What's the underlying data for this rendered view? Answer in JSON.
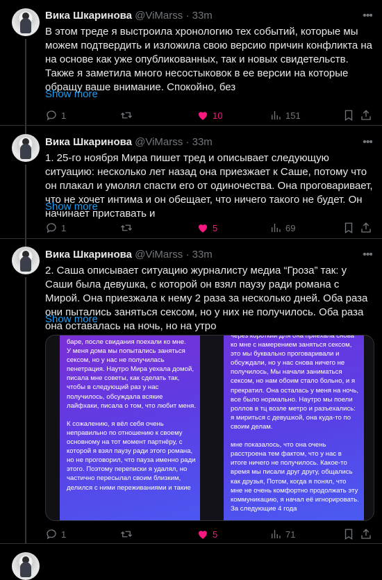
{
  "tweets": [
    {
      "author_name": "Вика Шкаринова",
      "handle": "@ViMarss",
      "dot": "·",
      "time": "33m",
      "text": "В этом треде я выстроила хронологию тех событий, которые мы можем подтвердить и изложила свою версию причин конфликта на на основе как уже опубликованных, так и новых свидетельств. Также я заметила много несостыковок в ее версии на которые обращу ваше внимание. Спокойно, без",
      "show_more": "Show more",
      "replies": "1",
      "reposts": "",
      "likes": "10",
      "views": "151"
    },
    {
      "author_name": "Вика Шкаринова",
      "handle": "@ViMarss",
      "dot": "·",
      "time": "33m",
      "text": "1. 25-го ноября Мира пишет тред и описывает следующую ситуацию: несколько лет назад она приезжает к Саше, потому что он плакал и умолял спасти его от одиночества. Она проговаривает, что не хочет интима и он обещает, что ничего такого не будет. Он начинает приставать и",
      "show_more": "Show more",
      "replies": "1",
      "reposts": "",
      "likes": "5",
      "views": "69"
    },
    {
      "author_name": "Вика Шкаринова",
      "handle": "@ViMarss",
      "dot": "·",
      "time": "33m",
      "text": "2. Саша описывает ситуацию журналисту медиа “Гроза” так: у Саши была девушка, с которой он взял паузу ради романа с Мирой. Она приезжала к нему 2 раза за несколько дней. Оба раза они пытались заняться сексом, но у них не получилось. Оба раза она оставалась на ночь, но на утро",
      "show_more": "Show more",
      "replies": "1",
      "reposts": "",
      "likes": "5",
      "views": "71",
      "media": {
        "left_text": "баре, после свидания поехали ко мне.\nУ меня дома мы попытались заняться сексом, но у нас не получилась пенетрация. Наутро Мира уехала домой, писала мне советы, как сделать так, чтобы в следующий раз у нас получилось, обсуждала всякие лайфхаки, писала о том, что любит меня.\n\nК сожалению, я вёл себя очень неправильно по отношению к своему основному на тот момент партнёру, с которой я взял паузу ради этого романа, но не проговорил, что пауза именно ради этого. Поэтому переписки я удалял, но частично пересылал своим близким, делился с ними переживаниями и такие",
        "right_text": "через короткий для она приехала снова ко мне с намерением заняться сексом, это мы буквально проговаривали и обсуждали, но у нас снова ничего не получилось, Мы начали заниматься сексом, но нам обоим стало больно, и я прекратил. Она осталась у меня на ночь, все было нормально. Наутро мы поели роллов в тц возле метро и разъехались: я мириться с девушкой, она куда-то по своим делам.\n\nмне показалось, что она очень расстроена тем фактом, что у нас в итоге ничего не получилось. Какое-то время мы писали друг другу, общались как друзья, Потом, когда я понял, что мне не очень комфортно продолжать эту коммуникацию, я начал её игнорировать. За следующие 4 года"
      }
    }
  ],
  "colors": {
    "background": "#000000",
    "text": "#e7e9ea",
    "muted": "#71767b",
    "link": "#1d9bf0",
    "like": "#f91880",
    "divider": "#2f3336"
  },
  "icons": [
    "more-icon",
    "reply-icon",
    "retweet-icon",
    "heart-icon",
    "views-icon",
    "bookmark-icon",
    "share-icon"
  ]
}
